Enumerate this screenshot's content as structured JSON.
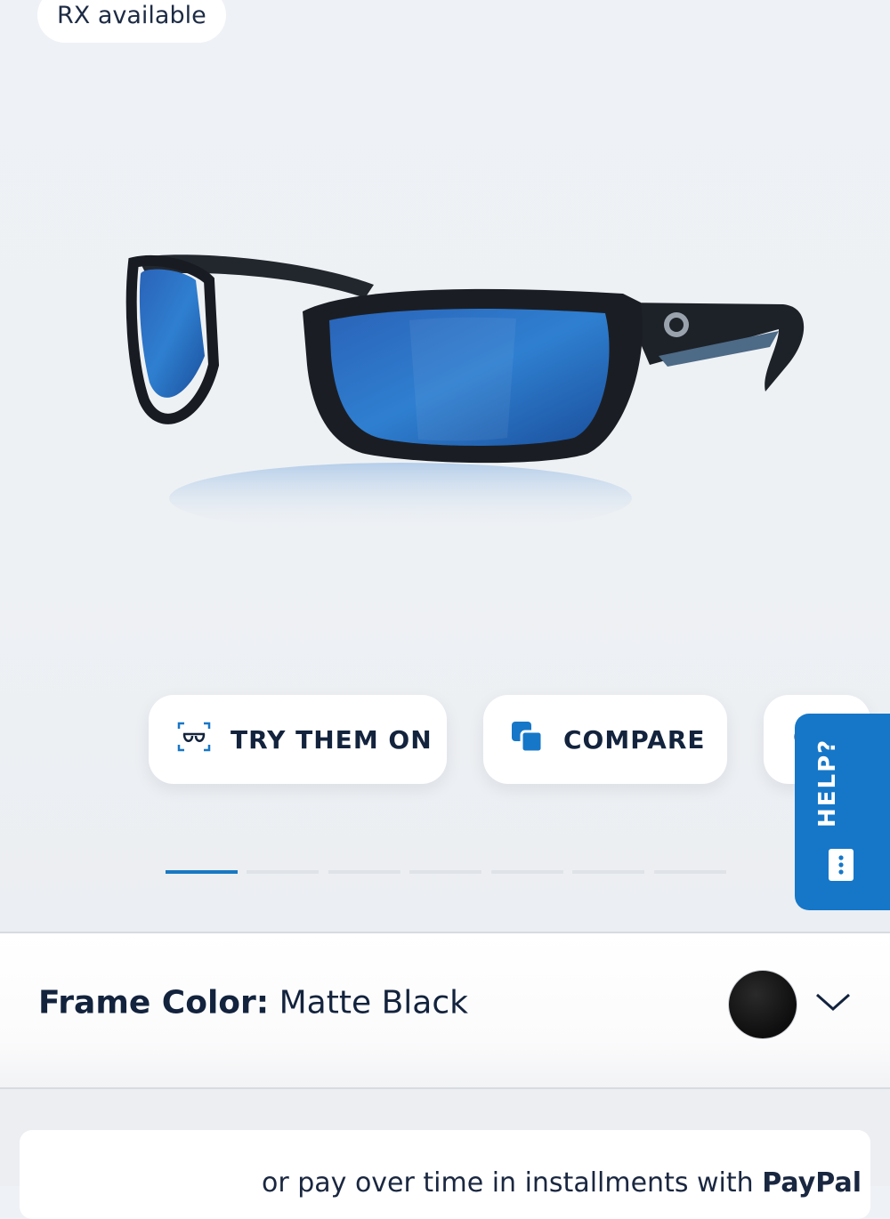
{
  "badge": {
    "rx": "RX available"
  },
  "actions": {
    "try_on_label": "TRY THEM ON",
    "compare_label": "COMPARE"
  },
  "help": {
    "label": "HELP?"
  },
  "frame": {
    "label": "Frame Color:",
    "value": "Matte Black",
    "swatch_color": "#111111"
  },
  "carousel": {
    "total_slides": 7,
    "active_index": 0
  },
  "payment": {
    "text": "or pay over time in installments with",
    "brand": "PayPal"
  },
  "colors": {
    "accent": "#1677c8",
    "text": "#13233d"
  }
}
